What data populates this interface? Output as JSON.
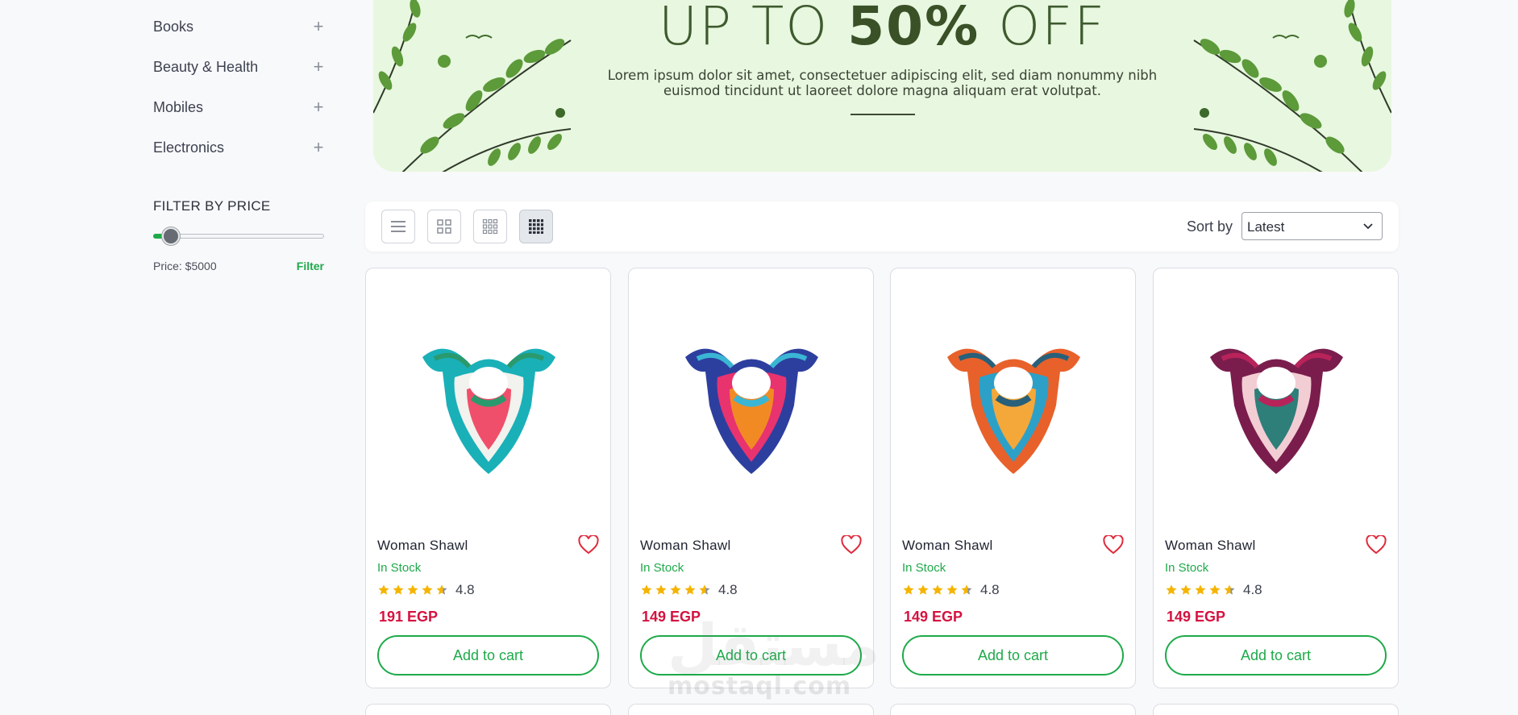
{
  "sidebar": {
    "categories": [
      {
        "label": "Books",
        "icon": "plus-icon"
      },
      {
        "label": "Beauty & Health",
        "icon": "plus-icon"
      },
      {
        "label": "Mobiles",
        "icon": "plus-icon"
      },
      {
        "label": "Electronics",
        "icon": "plus-icon"
      }
    ],
    "filter_title": "FILTER BY PRICE",
    "price_text": "Price: $5000",
    "filter_button": "Filter",
    "slider_fraction": 0.05
  },
  "banner": {
    "headline_pre": "UP TO",
    "headline_bold": "50%",
    "headline_post": "OFF",
    "body": "Lorem ipsum dolor sit amet, consectetuer adipiscing elit, sed diam nonummy nibh euismod tincidunt ut laoreet dolore magna aliquam erat volutpat."
  },
  "toolbar": {
    "view_modes": [
      "list-view-icon",
      "grid-2-icon",
      "grid-3-icon",
      "grid-4-icon"
    ],
    "active_view": "grid-4-icon",
    "sort_label": "Sort by",
    "sort_value": "Latest"
  },
  "products": [
    {
      "name": "Woman Shawl",
      "stock": "In Stock",
      "rating": "4.8",
      "price": "191 EGP",
      "button": "Add to cart",
      "colors": [
        "#1ab0b8",
        "#f2f2ee",
        "#ef4f6a",
        "#2a9a6e"
      ]
    },
    {
      "name": "Woman Shawl",
      "stock": "In Stock",
      "rating": "4.8",
      "price": "149 EGP",
      "button": "Add to cart",
      "colors": [
        "#2d3f9e",
        "#e8336f",
        "#f28a24",
        "#3ab6d4"
      ]
    },
    {
      "name": "Woman Shawl",
      "stock": "In Stock",
      "rating": "4.8",
      "price": "149 EGP",
      "button": "Add to cart",
      "colors": [
        "#e8612a",
        "#2da0c8",
        "#f5a83a",
        "#27607a"
      ]
    },
    {
      "name": "Woman Shawl",
      "stock": "In Stock",
      "rating": "4.8",
      "price": "149 EGP",
      "button": "Add to cart",
      "colors": [
        "#7a1d4d",
        "#f3cdd4",
        "#2e7f79",
        "#b8235a"
      ]
    }
  ],
  "watermark": {
    "ar": "مستقل",
    "en": "mostaql.com"
  },
  "colors": {
    "accent": "#1eaa4a",
    "price": "#d5123f",
    "heart": "#e02a3c",
    "star": "#f5b400",
    "banner_bg": "#e8f7df"
  }
}
